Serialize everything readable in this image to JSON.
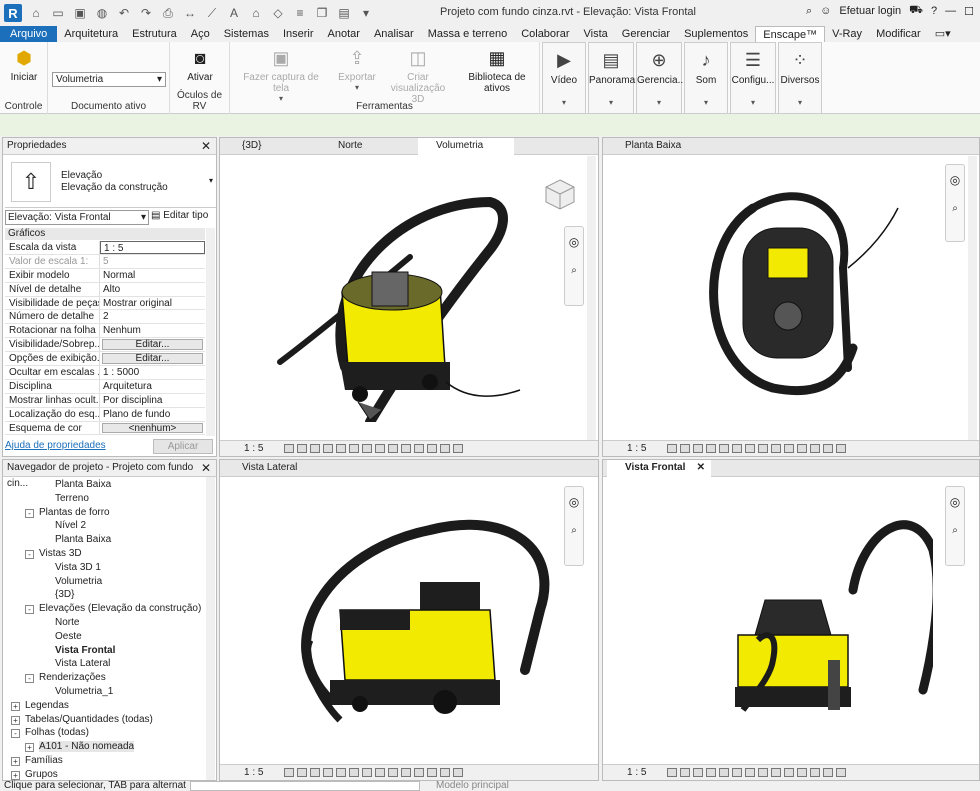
{
  "app": {
    "logo": "R",
    "doc_title": "Projeto com fundo cinza.rvt - Elevação: Vista Frontal",
    "login": "Efetuar login",
    "help": "?"
  },
  "ribbon_tabs": [
    "Arquivo",
    "Arquitetura",
    "Estrutura",
    "Aço",
    "Sistemas",
    "Inserir",
    "Anotar",
    "Analisar",
    "Massa e terreno",
    "Colaborar",
    "Vista",
    "Gerenciar",
    "Suplementos",
    "Enscape™",
    "V-Ray",
    "Modificar"
  ],
  "ribbon": {
    "iniciar": "Iniciar",
    "controle": "Controle",
    "documento_select": "Volumetria",
    "documento_label": "Documento ativo",
    "ativar": "Ativar",
    "oculos_label": "Óculos de RV",
    "fazer_captura": "Fazer captura de tela",
    "exportar": "Exportar",
    "criar_vis_1": "Criar visualização",
    "criar_vis_2": "3D",
    "biblioteca": "Biblioteca de ativos",
    "ferramentas_label": "Ferramentas",
    "video": "Vídeo",
    "panorama": "Panorama",
    "gerenciar": "Gerencia...",
    "som": "Som",
    "configuracoes": "Configu...",
    "diversos": "Diversos"
  },
  "properties": {
    "title": "Propriedades",
    "type_line1": "Elevação",
    "type_line2": "Elevação da construção",
    "instance_select": "Elevação: Vista Frontal",
    "edit_type": "Editar tipo",
    "section": "Gráficos",
    "rows": [
      {
        "k": "Escala da vista",
        "v": "1 : 5"
      },
      {
        "k": "Valor de escala    1:",
        "v": "5"
      },
      {
        "k": "Exibir modelo",
        "v": "Normal"
      },
      {
        "k": "Nível de detalhe",
        "v": "Alto"
      },
      {
        "k": "Visibilidade de peças",
        "v": "Mostrar original"
      },
      {
        "k": "Número de detalhe",
        "v": "2"
      },
      {
        "k": "Rotacionar na folha",
        "v": "Nenhum"
      },
      {
        "k": "Visibilidade/Sobrep...",
        "v": "Editar..."
      },
      {
        "k": "Opções de exibição...",
        "v": "Editar..."
      },
      {
        "k": "Ocultar em escalas ...",
        "v": "1 : 5000"
      },
      {
        "k": "Disciplina",
        "v": "Arquitetura"
      },
      {
        "k": "Mostrar linhas ocult...",
        "v": "Por disciplina"
      },
      {
        "k": "Localização do esq...",
        "v": "Plano de fundo"
      },
      {
        "k": "Esquema de cor",
        "v": "<nenhum>"
      }
    ],
    "help_link": "Ajuda de propriedades",
    "apply": "Aplicar"
  },
  "browser": {
    "title": "Navegador de projeto - Projeto com fundo cin...",
    "items": [
      "Planta Baixa",
      "Terreno",
      "Plantas de forro",
      "Nível 2",
      "Planta Baixa",
      "Vistas 3D",
      "Vista 3D 1",
      "Volumetria",
      "{3D}",
      "Elevações (Elevação da construção)",
      "Norte",
      "Oeste",
      "Vista Frontal",
      "Vista Lateral",
      "Renderizações",
      "Volumetria_1",
      "Legendas",
      "Tabelas/Quantidades (todas)",
      "Folhas (todas)",
      "A101 - Não nomeada",
      "Famílias",
      "Grupos"
    ]
  },
  "views": {
    "tabs_left": [
      "{3D}",
      "Norte",
      "Volumetria"
    ],
    "tab_planta": "Planta Baixa",
    "tab_lateral": "Vista Lateral",
    "tab_frontal": "Vista Frontal",
    "scale": "1 : 5"
  },
  "status": {
    "left": "Clique para selecionar, TAB para alternat",
    "model": "Modelo principal"
  },
  "colors": {
    "accent": "#1b6fbb",
    "yellow": "#f2ea00",
    "body": "#1e1e1e"
  }
}
